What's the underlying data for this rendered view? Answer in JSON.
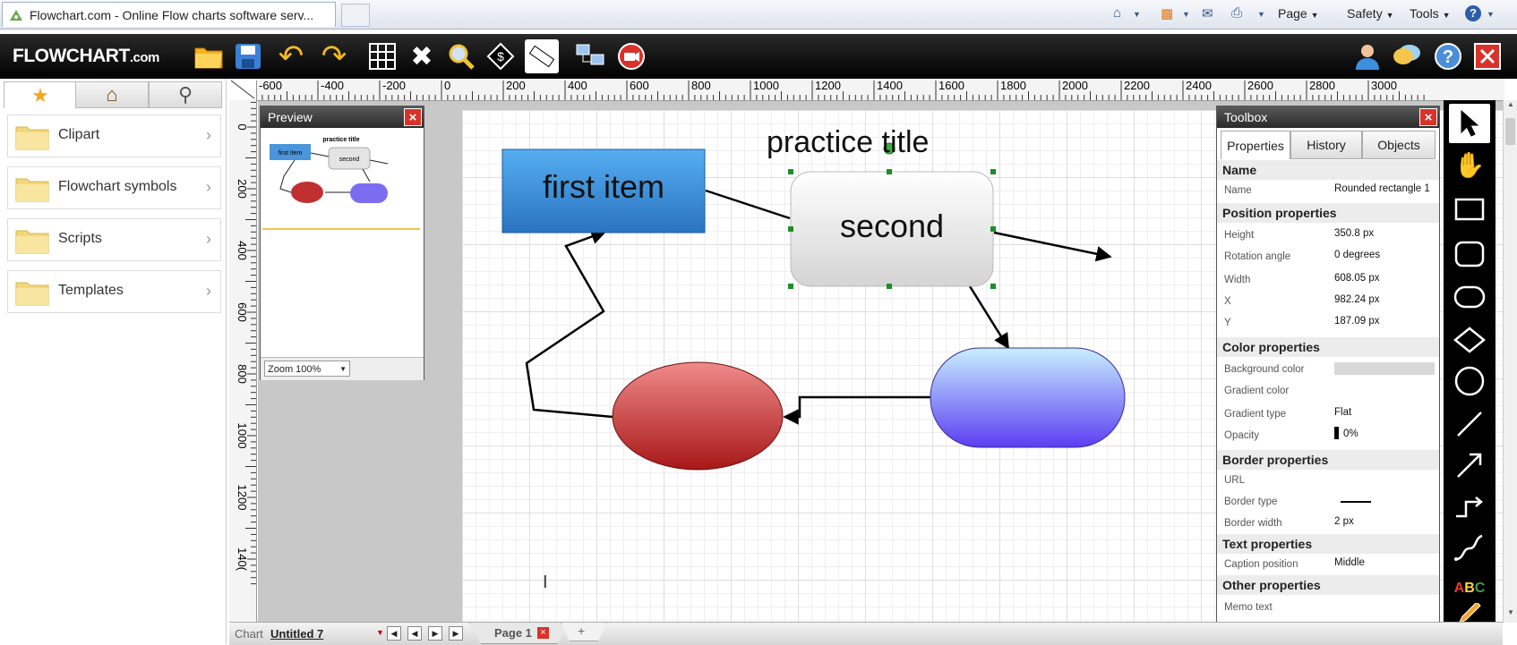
{
  "browser": {
    "tab_title": "Flowchart.com - Online Flow charts software serv...",
    "menus": [
      "Page",
      "Safety",
      "Tools"
    ],
    "toolbar_icons": [
      "home-icon",
      "rss-icon",
      "read-mail-icon",
      "print-icon",
      "help-icon"
    ]
  },
  "app": {
    "logo_main": "FLOWCHART",
    "logo_suffix": ".com",
    "toolbar_icons": [
      "open-folder-icon",
      "save-icon",
      "undo-icon",
      "redo-icon",
      "grid-icon",
      "tools-icon",
      "search-icon",
      "dollar-icon",
      "ruler-icon",
      "network-icon",
      "video-icon"
    ],
    "right_icons": [
      "user-icon",
      "chat-icon",
      "help-icon",
      "close-icon"
    ]
  },
  "left_panel": {
    "tabs": [
      "favorites-star-icon",
      "home-icon",
      "search-icon"
    ],
    "categories": [
      {
        "label": "Clipart"
      },
      {
        "label": "Flowchart symbols"
      },
      {
        "label": "Scripts"
      },
      {
        "label": "Templates"
      }
    ]
  },
  "ruler": {
    "top_labels": [
      "-600",
      "-400",
      "-200",
      "0",
      "200",
      "400",
      "600",
      "800",
      "1000",
      "1200",
      "1400",
      "1600",
      "1800",
      "2000",
      "2200",
      "2400",
      "2600",
      "2800",
      "3000"
    ],
    "left_labels": [
      "0",
      "200",
      "400",
      "600",
      "800",
      "1000",
      "1200",
      "140("
    ]
  },
  "preview": {
    "title": "Preview",
    "zoom": "Zoom 100%",
    "mini_title": "practice title",
    "mini_first": "first item",
    "mini_second": "second"
  },
  "diagram": {
    "title": "practice title",
    "first_item": "first item",
    "second": "second"
  },
  "toolbox": {
    "title": "Toolbox",
    "tabs": [
      "Properties",
      "History",
      "Objects"
    ],
    "sections": {
      "name": "Name",
      "position": "Position properties",
      "color": "Color properties",
      "border": "Border properties",
      "text": "Text properties",
      "other": "Other properties"
    },
    "props": {
      "name_label": "Name",
      "name_value": "Rounded rectangle 1",
      "height_label": "Height",
      "height_value": "350.8 px",
      "rotation_label": "Rotation angle",
      "rotation_value": "0 degrees",
      "width_label": "Width",
      "width_value": "608.05 px",
      "x_label": "X",
      "x_value": "982.24 px",
      "y_label": "Y",
      "y_value": "187.09 px",
      "bg_label": "Background color",
      "bg_value_color": "#d8d8d8",
      "gradcolor_label": "Gradient color",
      "gradtype_label": "Gradient type",
      "gradtype_value": "Flat",
      "opacity_label": "Opacity",
      "opacity_value": "0%",
      "url_label": "URL",
      "bordertype_label": "Border type",
      "borderwidth_label": "Border width",
      "borderwidth_value": "2 px",
      "caption_label": "Caption position",
      "caption_value": "Middle",
      "memo_label": "Memo text"
    }
  },
  "draw_tools": [
    "select-arrow-icon",
    "hand-icon",
    "rectangle-icon",
    "rounded-rectangle-icon",
    "ellipse-rounded-icon",
    "diamond-icon",
    "circle-icon",
    "line-icon",
    "arrow-line-icon",
    "elbow-connector-icon",
    "curve-connector-icon",
    "text-abc-icon",
    "pencil-icon"
  ],
  "bottom": {
    "chart_label": "Chart",
    "doc_name": "Untitled 7",
    "page_tab": "Page 1",
    "add_page": "+"
  },
  "colors": {
    "first_item_fill": "#3b8fd6",
    "ellipse_fill": "#c0392b",
    "pill_fill": "#7b6cf0",
    "close_red": "#d9322a"
  }
}
